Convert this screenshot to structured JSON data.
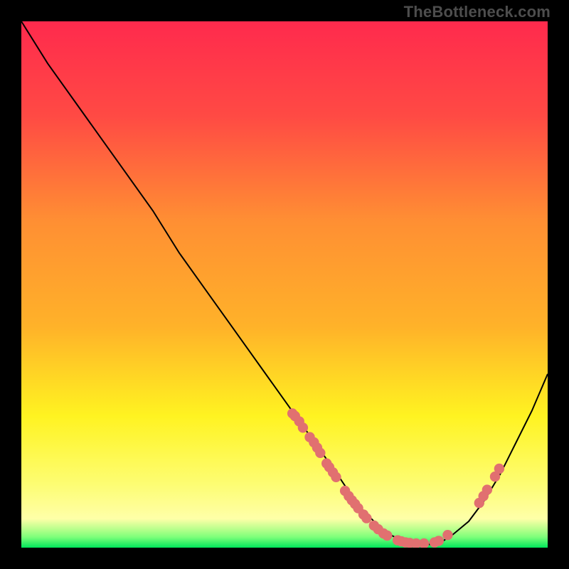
{
  "watermark": "TheBottleneck.com",
  "colors": {
    "plot_border": "#000000",
    "curve": "#000000",
    "marker_fill": "#e17070",
    "marker_stroke": "#d05858",
    "gradient_top": "#ff2a4d",
    "gradient_mid1": "#ff6a3a",
    "gradient_mid2": "#ffb229",
    "gradient_mid3": "#fff321",
    "gradient_mid4": "#fdfd73",
    "gradient_bottom_yellow": "#feffa8",
    "gradient_green_light": "#7dff7a",
    "gradient_green": "#00e55a"
  },
  "chart_data": {
    "type": "line",
    "title": "",
    "xlabel": "",
    "ylabel": "",
    "xlim": [
      0,
      100
    ],
    "ylim": [
      0,
      100
    ],
    "grid": false,
    "legend": false,
    "series": [
      {
        "name": "bottleneck-curve",
        "x": [
          0,
          5,
          10,
          15,
          20,
          25,
          30,
          35,
          40,
          45,
          50,
          55,
          60,
          62,
          65,
          68,
          70,
          72,
          75,
          78,
          80,
          82,
          85,
          88,
          91,
          94,
          97,
          100
        ],
        "y": [
          100,
          92,
          85,
          78,
          71,
          64,
          56,
          49,
          42,
          35,
          28,
          21,
          14,
          11,
          7,
          4,
          2.5,
          1.5,
          0.8,
          0.6,
          1.2,
          2.5,
          5,
          9,
          14,
          20,
          26,
          33
        ]
      }
    ],
    "markers": [
      {
        "x": 51.5,
        "y": 25.5
      },
      {
        "x": 52.0,
        "y": 25.0
      },
      {
        "x": 52.8,
        "y": 24.0
      },
      {
        "x": 53.5,
        "y": 22.8
      },
      {
        "x": 54.8,
        "y": 21.0
      },
      {
        "x": 55.6,
        "y": 20.0
      },
      {
        "x": 56.2,
        "y": 19.0
      },
      {
        "x": 56.8,
        "y": 18.0
      },
      {
        "x": 58.0,
        "y": 16.0
      },
      {
        "x": 58.5,
        "y": 15.3
      },
      {
        "x": 59.2,
        "y": 14.3
      },
      {
        "x": 59.8,
        "y": 13.4
      },
      {
        "x": 61.5,
        "y": 10.8
      },
      {
        "x": 62.2,
        "y": 9.8
      },
      {
        "x": 62.8,
        "y": 9.0
      },
      {
        "x": 63.4,
        "y": 8.3
      },
      {
        "x": 64.0,
        "y": 7.5
      },
      {
        "x": 65.0,
        "y": 6.3
      },
      {
        "x": 65.6,
        "y": 5.6
      },
      {
        "x": 67.0,
        "y": 4.2
      },
      {
        "x": 67.8,
        "y": 3.5
      },
      {
        "x": 68.8,
        "y": 2.7
      },
      {
        "x": 69.5,
        "y": 2.3
      },
      {
        "x": 71.5,
        "y": 1.4
      },
      {
        "x": 72.2,
        "y": 1.2
      },
      {
        "x": 73.0,
        "y": 1.0
      },
      {
        "x": 73.8,
        "y": 0.9
      },
      {
        "x": 75.0,
        "y": 0.8
      },
      {
        "x": 76.5,
        "y": 0.8
      },
      {
        "x": 78.5,
        "y": 1.0
      },
      {
        "x": 79.3,
        "y": 1.3
      },
      {
        "x": 81.0,
        "y": 2.4
      },
      {
        "x": 87.0,
        "y": 8.5
      },
      {
        "x": 87.8,
        "y": 9.8
      },
      {
        "x": 88.5,
        "y": 11.0
      },
      {
        "x": 90.0,
        "y": 13.5
      },
      {
        "x": 90.8,
        "y": 15.0
      }
    ]
  }
}
